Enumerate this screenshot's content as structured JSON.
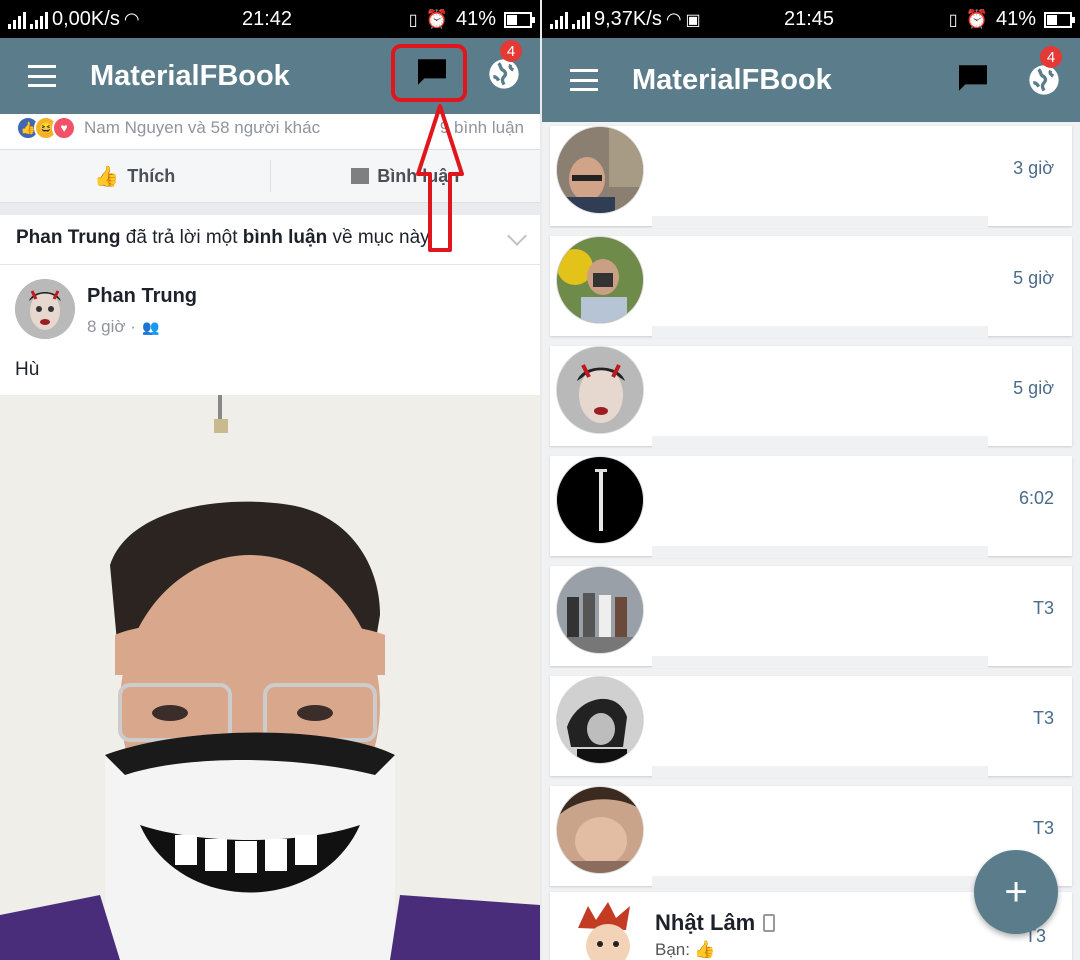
{
  "left": {
    "status": {
      "speed": "0,00K/s",
      "time": "21:42",
      "battery": "41%"
    },
    "appbar": {
      "title": "MaterialFBook",
      "notifications_badge": "4"
    },
    "reactions": {
      "text": "Nam Nguyen và 58 người khác",
      "comments": "9 bình luận"
    },
    "actions": {
      "like": "Thích",
      "comment": "Bình luận"
    },
    "notice": {
      "actor": "Phan Trung",
      "text1": " đã trả lời một ",
      "bold2": "bình luận",
      "text2": " về mục này."
    },
    "post": {
      "author": "Phan Trung",
      "time": "8 giờ ·",
      "text": "Hù"
    }
  },
  "right": {
    "status": {
      "speed": "9,37K/s",
      "time": "21:45",
      "battery": "41%"
    },
    "appbar": {
      "title": "MaterialFBook",
      "notifications_badge": "4"
    },
    "conversations": [
      {
        "time": "3 giờ"
      },
      {
        "time": "5 giờ"
      },
      {
        "time": "5 giờ"
      },
      {
        "time": "6:02"
      },
      {
        "time": "T3"
      },
      {
        "time": "T3"
      },
      {
        "time": "T3"
      }
    ],
    "last": {
      "name": "Nhật Lâm",
      "sub": "Bạn:",
      "time": "T3"
    },
    "fab_label": "+"
  },
  "colors": {
    "appbar": "#5b7c8b",
    "badge": "#e53935",
    "highlight": "#e0161d",
    "time_text": "#4b6b8a"
  }
}
